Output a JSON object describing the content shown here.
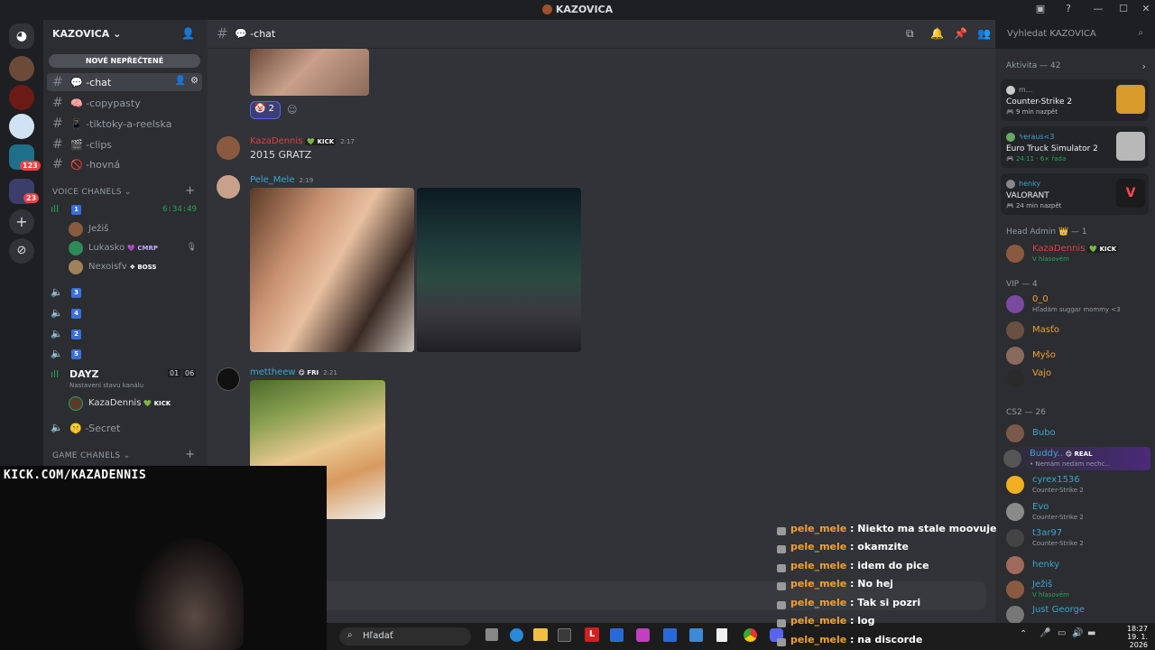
{
  "window": {
    "title": "KAZOVICA"
  },
  "server": {
    "name": "KAZOVICA",
    "new_unread": "NOVÉ NEPŘEČTENÉ"
  },
  "rail_badges": [
    "123",
    "23"
  ],
  "channels": [
    {
      "label": "💬 -chat",
      "selected": true
    },
    {
      "label": "🧠 -copypasty"
    },
    {
      "label": "📱 -tiktoky-a-reelska"
    },
    {
      "label": "🎬 -clips"
    },
    {
      "label": "🚫 -hovná"
    }
  ],
  "voice": {
    "category": "VOICE CHANELS",
    "room1_timer": "6:34:49",
    "room1_users": [
      {
        "name": "Ježiš",
        "tag": ""
      },
      {
        "name": "Lukasko",
        "tag": "CMRP"
      },
      {
        "name": "Nexoisfv",
        "tag": "BOSS"
      }
    ],
    "rooms": [
      "3",
      "4",
      "2",
      "5"
    ],
    "dayz": {
      "name": "DAYZ",
      "status": "Nastavení stavu kanálu",
      "count_a": "01",
      "count_b": "06",
      "user": "KazaDennis",
      "user_tag": "KICK"
    },
    "secret": "🤫 -Secret"
  },
  "game_category": "GAME CHANELS",
  "chat": {
    "channel": "💬 -chat",
    "reaction_count": "2",
    "messages": [
      {
        "author": "KazaDennis",
        "badge": "KICK",
        "time": "2:17",
        "text": "2015 GRATZ"
      },
      {
        "author": "Pele_Mele",
        "time": "2:19"
      },
      {
        "author": "mettheew",
        "badge": "FRI",
        "time": "2:21"
      }
    ]
  },
  "search": {
    "placeholder": "Vyhledat KAZOVICA"
  },
  "members": {
    "activity_header": "Aktivita — 42",
    "activities": [
      {
        "user": "m...",
        "game": "Counter-Strike 2",
        "when": "9 min nazpět"
      },
      {
        "user": "ϟeraus<3",
        "game": "Euro Truck Simulator 2",
        "when": "24:11 · 6× řada"
      },
      {
        "user": "henky",
        "game": "VALORANT",
        "when": "24 min nazpět"
      }
    ],
    "head_admin": "Head Admin 👑 — 1",
    "admin": {
      "name": "KazaDennis",
      "tag": "KICK",
      "status": "V hlasovém"
    },
    "vip": "VIP — 4",
    "vips": [
      {
        "name": "0_0",
        "status": "Hľadám suggar mommy <3"
      },
      {
        "name": "Masťo",
        "status": ""
      },
      {
        "name": "Myšo",
        "status": ""
      },
      {
        "name": "Vajo",
        "status": ""
      }
    ],
    "cs2": "CS2 — 26",
    "cs2_members": [
      {
        "name": "Bubo",
        "status": ""
      },
      {
        "name": "Buddy..",
        "tag": "REAL",
        "status": "• Nemám nedám nechc..."
      },
      {
        "name": "cyrex1536",
        "status": "Counter-Strike 2"
      },
      {
        "name": "Evo",
        "status": "Counter-Strike 2"
      },
      {
        "name": "t3ar97",
        "status": "Counter-Strike 2"
      },
      {
        "name": "henky",
        "status": ""
      },
      {
        "name": "Ježiš",
        "status": "V hlasovém"
      },
      {
        "name": "Just George",
        "status": ""
      }
    ]
  },
  "overlay": {
    "kick_url": "KICK.COM/KAZADENNIS",
    "kick_chat": [
      {
        "user": "pele_mele",
        "msg": "Niekto ma stale moovuje"
      },
      {
        "user": "pele_mele",
        "msg": "okamzite"
      },
      {
        "user": "pele_mele",
        "msg": "idem do pice"
      },
      {
        "user": "pele_mele",
        "msg": "No hej"
      },
      {
        "user": "pele_mele",
        "msg": "Tak si pozri"
      },
      {
        "user": "pele_mele",
        "msg": "log"
      },
      {
        "user": "pele_mele",
        "msg": "na discorde"
      }
    ]
  },
  "taskbar": {
    "search": "Hľadať",
    "time": "18:27",
    "date": "19. 1. 2026"
  }
}
